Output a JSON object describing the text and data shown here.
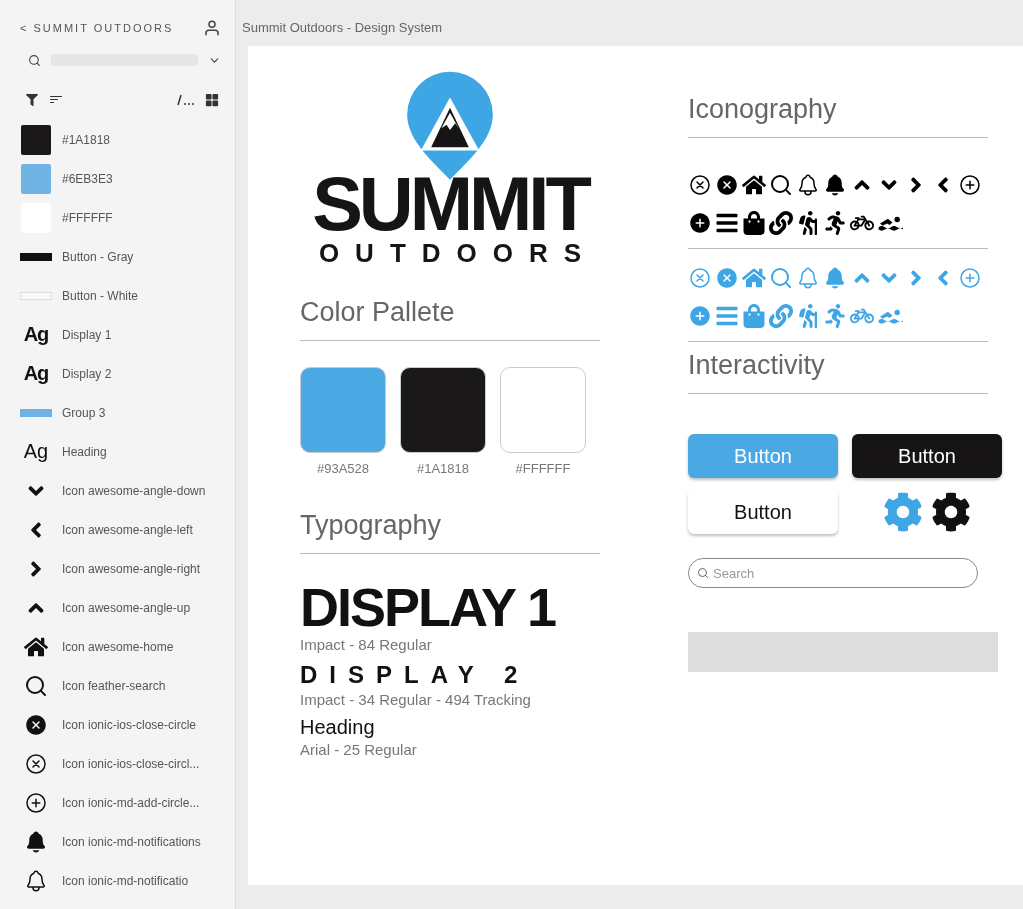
{
  "sidebar": {
    "title": "SUMMIT OUTDOORS",
    "back": "<",
    "items": [
      {
        "kind": "swatch",
        "label": "#1A1818",
        "color": "#1a1818"
      },
      {
        "kind": "swatch",
        "label": "#6EB3E3",
        "color": "#6eb3e3"
      },
      {
        "kind": "swatch",
        "label": "#FFFFFF",
        "color": "#ffffff"
      },
      {
        "kind": "dark-bar",
        "label": "Button - Gray"
      },
      {
        "kind": "light-bar",
        "label": "Button - White"
      },
      {
        "kind": "display-sample",
        "sample": "Ag",
        "label": "Display 1"
      },
      {
        "kind": "display-sample",
        "sample": "Ag",
        "label": "Display 2"
      },
      {
        "kind": "blue-bar",
        "label": "Group 3"
      },
      {
        "kind": "heading-sample",
        "sample": "Ag",
        "label": "Heading"
      },
      {
        "kind": "icon",
        "label": "Icon awesome-angle-down"
      },
      {
        "kind": "icon",
        "label": "Icon awesome-angle-left"
      },
      {
        "kind": "icon",
        "label": "Icon awesome-angle-right"
      },
      {
        "kind": "icon",
        "label": "Icon awesome-angle-up"
      },
      {
        "kind": "icon",
        "label": "Icon awesome-home"
      },
      {
        "kind": "icon",
        "label": "Icon feather-search"
      },
      {
        "kind": "icon",
        "label": "Icon ionic-ios-close-circle"
      },
      {
        "kind": "icon",
        "label": "Icon ionic-ios-close-circl..."
      },
      {
        "kind": "icon",
        "label": "Icon ionic-md-add-circle..."
      },
      {
        "kind": "icon",
        "label": "Icon ionic-md-notifications"
      },
      {
        "kind": "icon",
        "label": "Icon ionic-md-notificatio"
      }
    ]
  },
  "doc_title": "Summit Outdoors - Design System",
  "logo": {
    "word": "SUMMIT",
    "tagline": "OUTDOORS"
  },
  "palette": {
    "heading": "Color Pallete",
    "colors": [
      {
        "label": "#93A528",
        "color": "#4aa9e3"
      },
      {
        "label": "#1A1818",
        "color": "#1a1818"
      },
      {
        "label": "#FFFFFF",
        "color": "#ffffff"
      }
    ]
  },
  "typography": {
    "heading": "Typography",
    "samples": [
      {
        "kind": "display1",
        "text": "DISPLAY 1",
        "spec": "Impact - 84 Regular"
      },
      {
        "kind": "display2",
        "text": "DISPLAY 2",
        "spec": "Impact - 34 Regular - 494 Tracking"
      },
      {
        "kind": "heading",
        "text": "Heading",
        "spec": "Arial - 25 Regular"
      }
    ]
  },
  "iconography": {
    "heading": "Iconography",
    "sets": [
      {
        "color": "#000000"
      },
      {
        "color": "#3fa6e6"
      }
    ]
  },
  "interactivity": {
    "heading": "Interactivity",
    "buttons": [
      {
        "kind": "blue",
        "label": "Button"
      },
      {
        "kind": "dark",
        "label": "Button"
      },
      {
        "kind": "white",
        "label": "Button"
      }
    ],
    "gears": [
      {
        "color": "#3fa6e6"
      },
      {
        "color": "#111111"
      }
    ],
    "search": {
      "placeholder": "Search"
    }
  }
}
